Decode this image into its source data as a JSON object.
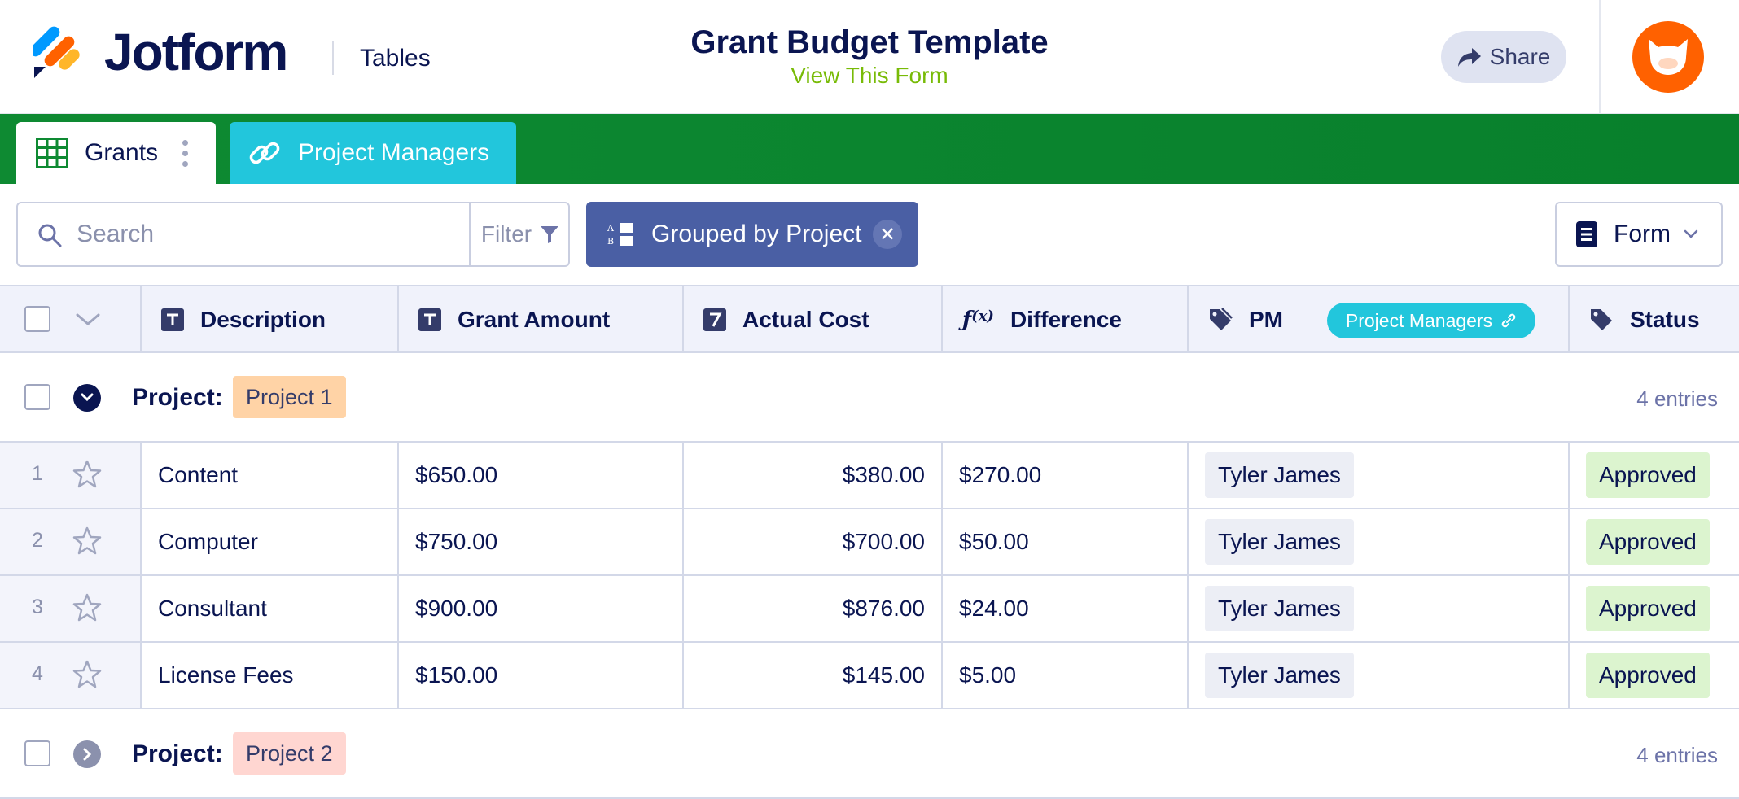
{
  "header": {
    "brand": "Jotform",
    "product": "Tables",
    "title": "Grant Budget Template",
    "view_link": "View This Form",
    "share_label": "Share"
  },
  "tabs": [
    {
      "label": "Grants",
      "icon": "grid-icon",
      "active": true
    },
    {
      "label": "Project Managers",
      "icon": "link-icon",
      "active": false
    }
  ],
  "toolbar": {
    "search_placeholder": "Search",
    "filter_label": "Filter",
    "group_label": "Grouped by Project",
    "form_label": "Form"
  },
  "columns": [
    {
      "label": "Description",
      "icon": "text-type-icon"
    },
    {
      "label": "Grant Amount",
      "icon": "text-type-icon"
    },
    {
      "label": "Actual Cost",
      "icon": "number-type-icon"
    },
    {
      "label": "Difference",
      "icon": "formula-type-icon"
    },
    {
      "label": "PM",
      "icon": "tag-icon",
      "link_chip": "Project Managers"
    },
    {
      "label": "Status",
      "icon": "tag-icon"
    }
  ],
  "groups": [
    {
      "label": "Project:",
      "name": "Project 1",
      "count": "4 entries",
      "expanded": true,
      "tag_color": "#ffd3a6",
      "rows": [
        {
          "num": "1",
          "description": "Content",
          "grant_amount": "$650.00",
          "actual_cost": "$380.00",
          "difference": "$270.00",
          "pm": "Tyler James",
          "status": "Approved"
        },
        {
          "num": "2",
          "description": "Computer",
          "grant_amount": "$750.00",
          "actual_cost": "$700.00",
          "difference": "$50.00",
          "pm": "Tyler James",
          "status": "Approved"
        },
        {
          "num": "3",
          "description": "Consultant",
          "grant_amount": "$900.00",
          "actual_cost": "$876.00",
          "difference": "$24.00",
          "pm": "Tyler James",
          "status": "Approved"
        },
        {
          "num": "4",
          "description": "License Fees",
          "grant_amount": "$150.00",
          "actual_cost": "$145.00",
          "difference": "$5.00",
          "pm": "Tyler James",
          "status": "Approved"
        }
      ]
    },
    {
      "label": "Project:",
      "name": "Project 2",
      "count": "4 entries",
      "expanded": false,
      "tag_color": "#ffd6d1"
    }
  ],
  "colors": {
    "brand_navy": "#0a1551",
    "tabbar_green": "#0e8a32",
    "tab_cyan": "#22c6dc",
    "group_chip": "#4a5fa4",
    "avatar_orange": "#ff6100",
    "approved_bg": "#dcf4cf"
  }
}
